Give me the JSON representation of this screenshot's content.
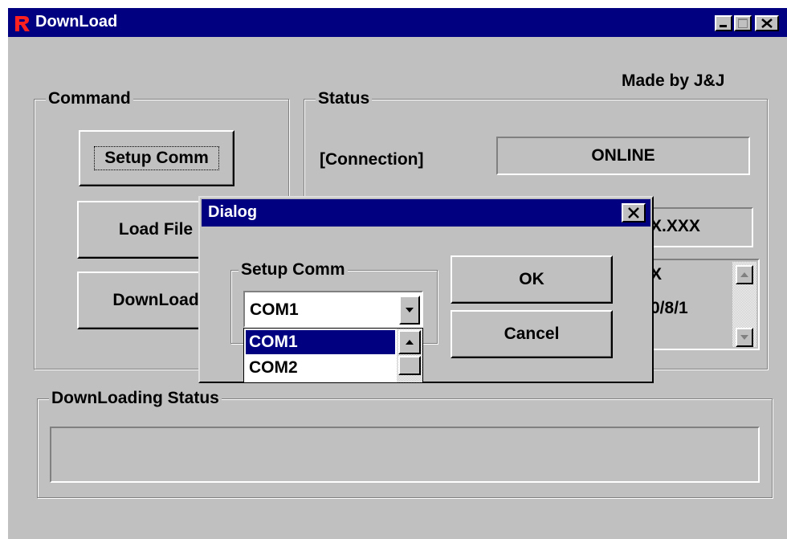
{
  "window": {
    "title": "DownLoad",
    "made_by": "Made by J&J"
  },
  "command": {
    "group_title": "Command",
    "buttons": {
      "setup": "Setup Comm",
      "load": "Load File",
      "download": "DownLoad"
    }
  },
  "status": {
    "group_title": "Status",
    "connection_label": "[Connection]",
    "connection_value": "ONLINE",
    "field2_value_visible": "X.XXX",
    "list_partial_line1": "X",
    "list_partial_line2": "0/8/1"
  },
  "downloading": {
    "group_title": "DownLoading Status",
    "progress_percent": 0
  },
  "dialog": {
    "title": "Dialog",
    "group_title": "Setup Comm",
    "selected_port": "COM1",
    "port_options": [
      "COM1",
      "COM2"
    ],
    "highlighted_index": 0,
    "ok_label": "OK",
    "cancel_label": "Cancel"
  },
  "colors": {
    "titlebar": "#000080",
    "face": "#c0c0c0",
    "highlight": "#000080"
  }
}
